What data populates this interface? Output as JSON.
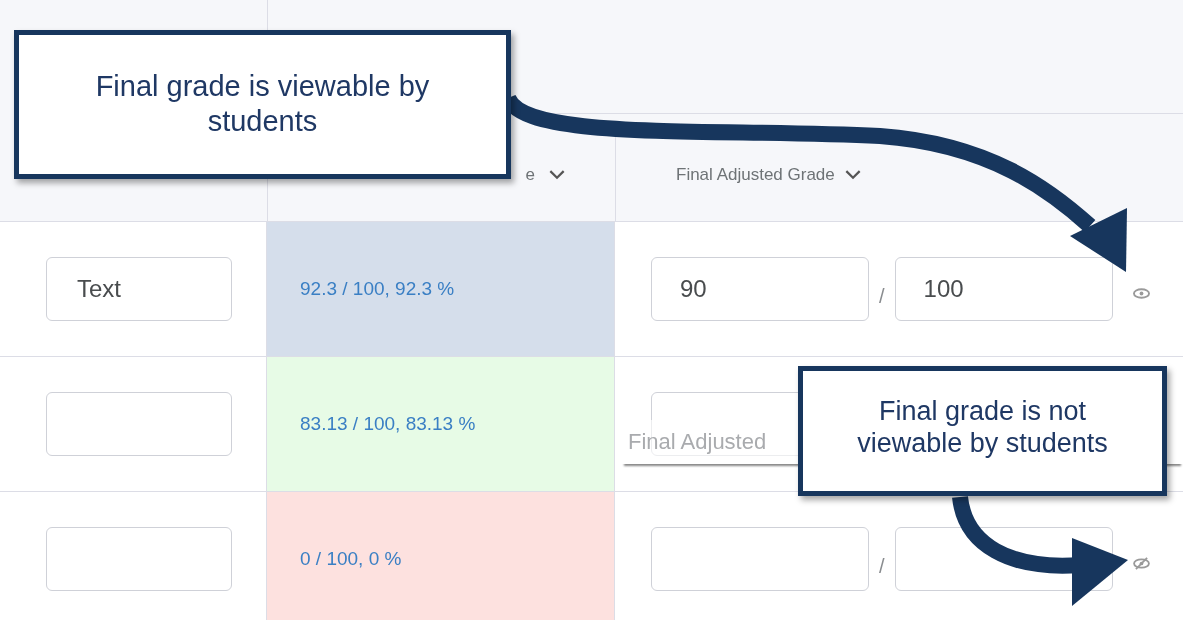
{
  "table": {
    "columns": [
      {
        "label": "e"
      },
      {
        "label": "Final Adjusted Grade"
      }
    ],
    "rows": [
      {
        "text_value": "Text",
        "grade": "92.3 / 100, 92.3 %",
        "color": "#d5deeb",
        "numerator": "90",
        "separator": "/",
        "denominator": "100",
        "viewable": true
      },
      {
        "grade": "83.13 / 100, 83.13 %",
        "color": "#e7fbe6"
      },
      {
        "grade": "0 / 100, 0 %",
        "color": "#fde1df",
        "separator": "/",
        "viewable": false
      }
    ]
  },
  "tooltip": {
    "text": "Final Adjusted"
  },
  "callouts": [
    {
      "text": "Final grade is viewable by students"
    },
    {
      "text": "Final grade is not viewable by students"
    }
  ]
}
